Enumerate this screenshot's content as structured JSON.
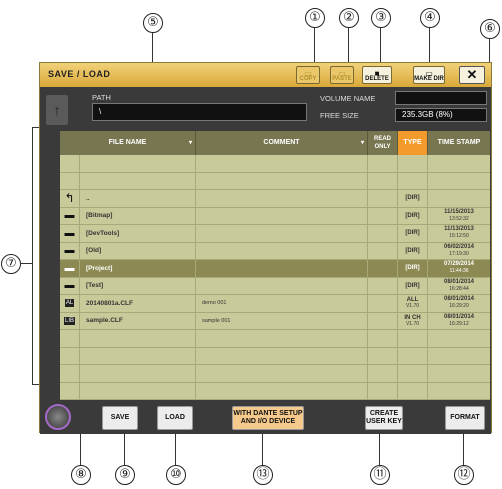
{
  "callouts": {
    "c1": "①",
    "c2": "②",
    "c3": "③",
    "c4": "④",
    "c5": "⑤",
    "c6": "⑥",
    "c7": "⑦",
    "c8": "⑧",
    "c9": "⑨",
    "c10": "⑩",
    "c11": "⑪",
    "c12": "⑫",
    "c13": "⑬"
  },
  "window": {
    "title": "SAVE / LOAD",
    "close_label": "✕"
  },
  "toolbar": {
    "copy_label": "COPY",
    "paste_label": "PASTE",
    "delete_label": "DELETE",
    "make_dir_label": "MAKE DIR"
  },
  "path": {
    "label": "PATH",
    "value": "\\"
  },
  "volume": {
    "name_label": "VOLUME NAME",
    "name_value": "",
    "free_label": "FREE SIZE",
    "free_value": "235.3GB (8%)"
  },
  "table": {
    "headers": {
      "file_name": "FILE NAME",
      "comment": "COMMENT",
      "read_only": "READ ONLY",
      "type": "TYPE",
      "time_stamp": "TIME STAMP"
    },
    "rows": [
      {
        "icon": "",
        "name": "",
        "comment": "",
        "type": "",
        "type2": "",
        "date": "",
        "time": ""
      },
      {
        "icon": "",
        "name": "",
        "comment": "",
        "type": "",
        "type2": "",
        "date": "",
        "time": ""
      },
      {
        "icon": "up",
        "name": "..",
        "comment": "",
        "type": "[DIR]",
        "type2": "",
        "date": "",
        "time": ""
      },
      {
        "icon": "folder",
        "name": "[Bitmap]",
        "comment": "",
        "type": "[DIR]",
        "type2": "",
        "date": "11/15/2013",
        "time": "13:52:32"
      },
      {
        "icon": "folder",
        "name": "[DevTools]",
        "comment": "",
        "type": "[DIR]",
        "type2": "",
        "date": "11/13/2013",
        "time": "15:12:50"
      },
      {
        "icon": "folder",
        "name": "[Old]",
        "comment": "",
        "type": "[DIR]",
        "type2": "",
        "date": "06/02/2014",
        "time": "17:19:30"
      },
      {
        "icon": "folder",
        "name": "[Project]",
        "comment": "",
        "type": "[DIR]",
        "type2": "",
        "date": "07/29/2014",
        "time": "11:44:36",
        "selected": true
      },
      {
        "icon": "folder",
        "name": "[Test]",
        "comment": "",
        "type": "[DIR]",
        "type2": "",
        "date": "08/01/2014",
        "time": "16:28:44"
      },
      {
        "icon": "all",
        "name": "20140801a.CLF",
        "comment": "demo 001",
        "type": "ALL",
        "type2": "V1.70",
        "date": "08/01/2014",
        "time": "16:29:20"
      },
      {
        "icon": "lib",
        "name": "sample.CLF",
        "comment": "sample 001",
        "type": "IN CH",
        "type2": "V1.70",
        "date": "08/01/2014",
        "time": "16:29:12"
      },
      {
        "icon": "",
        "name": "",
        "comment": "",
        "type": "",
        "type2": "",
        "date": "",
        "time": ""
      },
      {
        "icon": "",
        "name": "",
        "comment": "",
        "type": "",
        "type2": "",
        "date": "",
        "time": ""
      },
      {
        "icon": "",
        "name": "",
        "comment": "",
        "type": "",
        "type2": "",
        "date": "",
        "time": ""
      },
      {
        "icon": "",
        "name": "",
        "comment": "",
        "type": "",
        "type2": "",
        "date": "",
        "time": ""
      }
    ]
  },
  "bottom": {
    "save_label": "SAVE",
    "load_label": "LOAD",
    "dante_label": "WITH DANTE SETUP AND I/O DEVICE",
    "create_key_label": "CREATE USER KEY",
    "format_label": "FORMAT"
  },
  "colors": {
    "title_bar": "#e6b548",
    "selected_row": "#8c8a52",
    "type_header": "#f39a2c",
    "knob_ring": "#a56ac9"
  }
}
